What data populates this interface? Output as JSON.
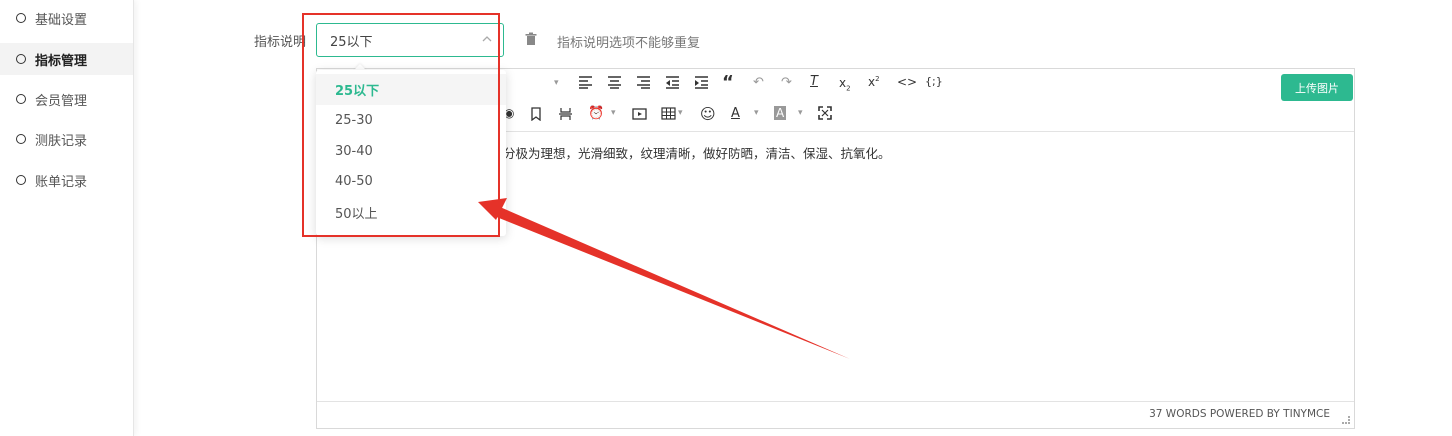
{
  "sidebar": {
    "items": [
      {
        "label": "基础设置",
        "active": false
      },
      {
        "label": "指标管理",
        "active": true
      },
      {
        "label": "会员管理",
        "active": false
      },
      {
        "label": "测肤记录",
        "active": false
      },
      {
        "label": "账单记录",
        "active": false
      }
    ]
  },
  "form": {
    "field_label": "指标说明",
    "select_value": "25以下",
    "hint": "指标说明选项不能够重复"
  },
  "dropdown": {
    "options": [
      "25以下",
      "25-30",
      "30-40",
      "40-50",
      "50以上"
    ],
    "selected": "25以下"
  },
  "editor": {
    "upload_label": "上传图片",
    "content_text": "分极为理想，光滑细致，纹理清晰，做好防晒，清洁、保湿、抗氧化。",
    "status_text": "37 WORDS POWERED BY TINYMCE",
    "toolbar_row1_icons": [
      "align-left-icon",
      "align-center-icon",
      "align-right-icon",
      "outdent-icon",
      "indent-icon",
      "blockquote-icon",
      "undo-icon",
      "redo-icon",
      "clear-format-icon",
      "subscript-icon",
      "superscript-icon",
      "code-icon",
      "code-sample-icon"
    ],
    "toolbar_row2_icons": [
      "preview-icon",
      "bookmark-icon",
      "page-break-icon",
      "alarm-icon",
      "media-icon",
      "table-icon",
      "emoticon-icon",
      "text-color-icon",
      "background-color-icon",
      "fullscreen-icon"
    ]
  },
  "colors": {
    "accent": "#2db990",
    "annotation": "#e53229"
  }
}
